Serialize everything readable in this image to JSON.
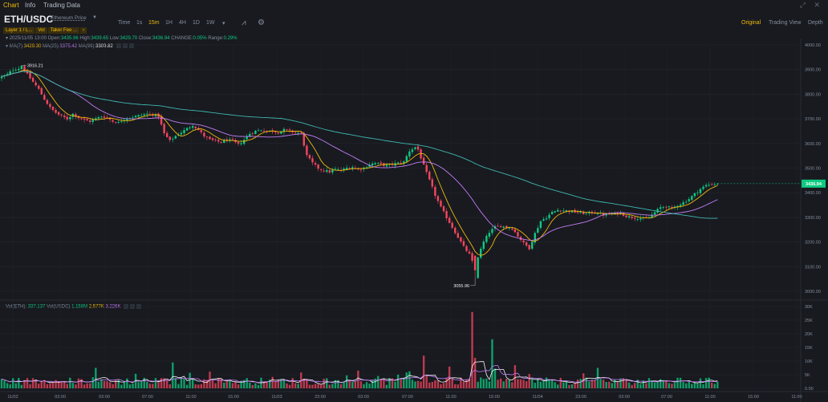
{
  "topbar": {
    "tabs": [
      {
        "label": "Chart",
        "active": true
      },
      {
        "label": "Info",
        "active": false
      },
      {
        "label": "Trading Data",
        "active": false
      }
    ]
  },
  "toolbar": {
    "pair": "ETH/USDC",
    "price_type": "Ethereum Price",
    "intervals": [
      {
        "label": "Time",
        "active": false
      },
      {
        "label": "1s",
        "active": false
      },
      {
        "label": "15m",
        "active": true
      },
      {
        "label": "1H",
        "active": false
      },
      {
        "label": "4H",
        "active": false
      },
      {
        "label": "1D",
        "active": false
      },
      {
        "label": "1W",
        "active": false
      }
    ],
    "views": [
      {
        "label": "Original",
        "active": true
      },
      {
        "label": "Trading View",
        "active": false
      },
      {
        "label": "Depth",
        "active": false
      }
    ],
    "chips": [
      "Layer 1 / L...",
      "Vol",
      "Taker Fee ..."
    ]
  },
  "ohlc": {
    "date": "2025/11/05 13:00",
    "open_label": "Open:",
    "open": "3435.96",
    "high_label": "High:",
    "high": "3439.65",
    "low_label": "Low:",
    "low": "3429.70",
    "close_label": "Close:",
    "close": "3436.94",
    "change_label": "CHANGE:",
    "change": "0.05%",
    "range_label": "Range:",
    "range": "0.29%"
  },
  "ma": {
    "ma7_label": "MA(7):",
    "ma7": "3429.30",
    "ma25_label": "MA(25):",
    "ma25": "3375.42",
    "ma99_label": "MA(99):",
    "ma99": "3309.82"
  },
  "vol": {
    "eth_label": "Vol(ETH):",
    "eth": "337.137",
    "usdc_label": "Vol(USDC)",
    "usdc": "1.158M",
    "ma5": "2.577K",
    "ma10": "3.226K"
  },
  "colors": {
    "up": "#0ecb81",
    "down": "#f6465d",
    "ma7": "#f0b90b",
    "ma25": "#c27cf2",
    "ma99": "#3fb6ad",
    "accent": "#f0b90b",
    "background": "#181a20"
  },
  "chart_data": [
    {
      "type": "candlestick",
      "interval": "15m",
      "yticks": [
        "4000.00",
        "3900.00",
        "3800.00",
        "3700.00",
        "3600.00",
        "3500.00",
        "3400.00",
        "3300.00",
        "3200.00",
        "3100.00",
        "3000.00"
      ],
      "ylim": [
        2970,
        4020
      ],
      "xticks": [
        "11/02",
        "03:00",
        "03:00",
        "07:00",
        "11:00",
        "15:00",
        "11/03",
        "23:00",
        "03:00",
        "07:00",
        "11:00",
        "15:00",
        "11/04",
        "23:00",
        "03:00",
        "07:00",
        "11:00",
        "15:00",
        "11:00"
      ],
      "last_price": "3436.94",
      "annotations": {
        "high": "3916.21",
        "low": "3055.96"
      },
      "price_path": [
        [
          0,
          3870
        ],
        [
          2,
          3880
        ],
        [
          4,
          3900
        ],
        [
          6,
          3905
        ],
        [
          7,
          3916.21
        ],
        [
          9,
          3880
        ],
        [
          11,
          3850
        ],
        [
          13,
          3820
        ],
        [
          15,
          3780
        ],
        [
          17,
          3745
        ],
        [
          19,
          3725
        ],
        [
          21,
          3710
        ],
        [
          23,
          3700
        ],
        [
          25,
          3720
        ],
        [
          27,
          3705
        ],
        [
          29,
          3695
        ],
        [
          31,
          3690
        ],
        [
          33,
          3700
        ],
        [
          35,
          3710
        ],
        [
          37,
          3705
        ],
        [
          39,
          3690
        ],
        [
          41,
          3685
        ],
        [
          43,
          3700
        ],
        [
          45,
          3705
        ],
        [
          47,
          3710
        ],
        [
          49,
          3715
        ],
        [
          51,
          3720
        ],
        [
          53,
          3718
        ],
        [
          55,
          3710
        ],
        [
          57,
          3640
        ],
        [
          59,
          3610
        ],
        [
          61,
          3630
        ],
        [
          63,
          3645
        ],
        [
          65,
          3660
        ],
        [
          67,
          3675
        ],
        [
          69,
          3655
        ],
        [
          71,
          3630
        ],
        [
          73,
          3615
        ],
        [
          75,
          3610
        ],
        [
          77,
          3605
        ],
        [
          79,
          3615
        ],
        [
          81,
          3610
        ],
        [
          83,
          3595
        ],
        [
          85,
          3615
        ],
        [
          87,
          3640
        ],
        [
          89,
          3650
        ],
        [
          91,
          3655
        ],
        [
          93,
          3650
        ],
        [
          95,
          3650
        ],
        [
          97,
          3645
        ],
        [
          99,
          3655
        ],
        [
          101,
          3650
        ],
        [
          103,
          3645
        ],
        [
          105,
          3640
        ],
        [
          107,
          3550
        ],
        [
          109,
          3520
        ],
        [
          111,
          3500
        ],
        [
          113,
          3490
        ],
        [
          115,
          3485
        ],
        [
          117,
          3495
        ],
        [
          119,
          3490
        ],
        [
          121,
          3500
        ],
        [
          123,
          3505
        ],
        [
          125,
          3495
        ],
        [
          127,
          3500
        ],
        [
          129,
          3515
        ],
        [
          131,
          3520
        ],
        [
          133,
          3515
        ],
        [
          135,
          3510
        ],
        [
          137,
          3515
        ],
        [
          139,
          3520
        ],
        [
          141,
          3525
        ],
        [
          143,
          3570
        ],
        [
          145,
          3585
        ],
        [
          146,
          3575
        ],
        [
          148,
          3510
        ],
        [
          150,
          3450
        ],
        [
          152,
          3390
        ],
        [
          154,
          3340
        ],
        [
          156,
          3300
        ],
        [
          158,
          3260
        ],
        [
          160,
          3220
        ],
        [
          162,
          3180
        ],
        [
          164,
          3150
        ],
        [
          165,
          3120
        ],
        [
          166,
          3055.96
        ],
        [
          167,
          3140
        ],
        [
          169,
          3200
        ],
        [
          171,
          3240
        ],
        [
          173,
          3260
        ],
        [
          175,
          3265
        ],
        [
          177,
          3260
        ],
        [
          179,
          3255
        ],
        [
          181,
          3225
        ],
        [
          183,
          3195
        ],
        [
          185,
          3175
        ],
        [
          187,
          3235
        ],
        [
          189,
          3285
        ],
        [
          191,
          3300
        ],
        [
          193,
          3320
        ],
        [
          195,
          3330
        ],
        [
          197,
          3328
        ],
        [
          199,
          3325
        ],
        [
          201,
          3322
        ],
        [
          203,
          3318
        ],
        [
          205,
          3315
        ],
        [
          207,
          3320
        ],
        [
          209,
          3318
        ],
        [
          211,
          3310
        ],
        [
          213,
          3312
        ],
        [
          215,
          3315
        ],
        [
          217,
          3318
        ],
        [
          219,
          3305
        ],
        [
          221,
          3300
        ],
        [
          223,
          3298
        ],
        [
          225,
          3295
        ],
        [
          227,
          3300
        ],
        [
          229,
          3320
        ],
        [
          231,
          3340
        ],
        [
          233,
          3345
        ],
        [
          235,
          3335
        ],
        [
          237,
          3350
        ],
        [
          239,
          3360
        ],
        [
          241,
          3375
        ],
        [
          243,
          3395
        ],
        [
          245,
          3415
        ],
        [
          247,
          3430
        ],
        [
          249,
          3435
        ],
        [
          251,
          3436.94
        ]
      ]
    },
    {
      "type": "bar",
      "title": "Volume",
      "yticks": [
        "30K",
        "25K",
        "20K",
        "15K",
        "10K",
        "5K",
        "0.00"
      ],
      "ylim": [
        0,
        30000
      ],
      "spikes": [
        [
          60,
          9500
        ],
        [
          165,
          28000
        ],
        [
          172,
          18000
        ],
        [
          148,
          12000
        ],
        [
          180,
          8500
        ],
        [
          157,
          8000
        ],
        [
          125,
          6500
        ],
        [
          204,
          5500
        ]
      ]
    }
  ]
}
